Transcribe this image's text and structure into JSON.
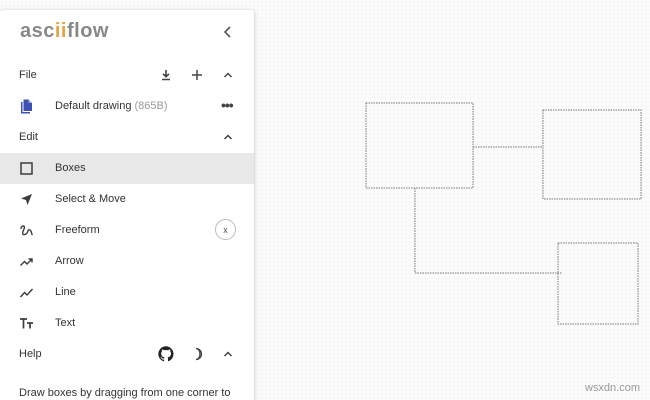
{
  "app": {
    "logo_prefix": "asc",
    "logo_accent": "ii",
    "logo_suffix": "flow"
  },
  "file_section": {
    "label": "File",
    "icons": [
      "download-icon",
      "plus-icon",
      "chevron-up-icon"
    ]
  },
  "drawing": {
    "name": "Default drawing",
    "size": "(865B)",
    "icon": "document-icon"
  },
  "edit_section": {
    "label": "Edit",
    "icons": [
      "chevron-up-icon"
    ]
  },
  "tools": [
    {
      "label": "Boxes",
      "icon": "box-icon",
      "selected": true
    },
    {
      "label": "Select & Move",
      "icon": "cursor-arrow-icon",
      "selected": false
    },
    {
      "label": "Freeform",
      "icon": "freeform-icon",
      "selected": false
    },
    {
      "label": "Arrow",
      "icon": "arrow-icon",
      "selected": false
    },
    {
      "label": "Line",
      "icon": "line-icon",
      "selected": false
    },
    {
      "label": "Text",
      "icon": "text-icon",
      "selected": false
    }
  ],
  "freeform_clear": "x",
  "help_section": {
    "label": "Help",
    "icons": [
      "github-icon",
      "moon-icon",
      "chevron-up-icon"
    ]
  },
  "help_text": "Draw boxes by dragging from one corner to",
  "watermark": "wsxdn.com",
  "colors": {
    "accent": "#e8a33c",
    "selected_bg": "#e8e8e8",
    "icon": "#3c3c3c",
    "drawing_icon": "#3f51b5"
  }
}
